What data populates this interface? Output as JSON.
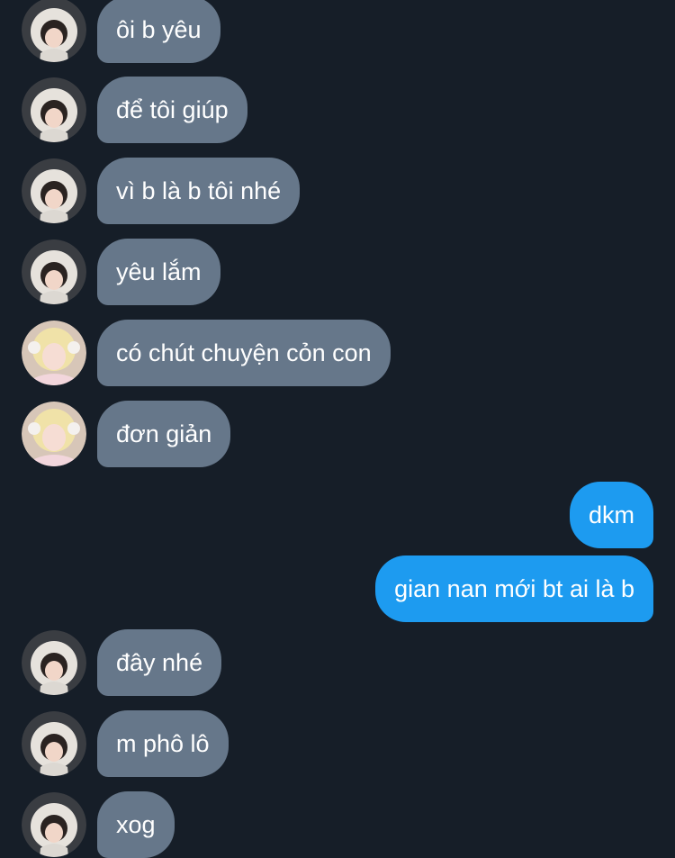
{
  "conversation": {
    "messages": [
      {
        "side": "in",
        "text": "ôi b yêu",
        "avatar": "hooded-girl-avatar"
      },
      {
        "side": "in",
        "text": "để tôi giúp",
        "avatar": "hooded-girl-avatar"
      },
      {
        "side": "in",
        "text": "vì b là b tôi nhé",
        "avatar": "hooded-girl-avatar"
      },
      {
        "side": "in",
        "text": "yêu lắm",
        "avatar": "hooded-girl-avatar"
      },
      {
        "side": "in",
        "text": "có chút chuyện cỏn con",
        "avatar": "blonde-girl-avatar"
      },
      {
        "side": "in",
        "text": "đơn giản",
        "avatar": "blonde-girl-avatar"
      },
      {
        "side": "out",
        "text": "dkm"
      },
      {
        "side": "out",
        "text": "gian nan mới bt ai là b"
      },
      {
        "side": "in",
        "text": "đây nhé",
        "avatar": "hooded-girl-avatar"
      },
      {
        "side": "in",
        "text": "m phô lô",
        "avatar": "hooded-girl-avatar"
      },
      {
        "side": "in",
        "text": "xog",
        "avatar": "hooded-girl-avatar"
      }
    ]
  },
  "theme": {
    "background": "#161e28",
    "incoming_bubble": "#66778a",
    "outgoing_bubble": "#1d9bf0",
    "text": "#ffffff"
  }
}
